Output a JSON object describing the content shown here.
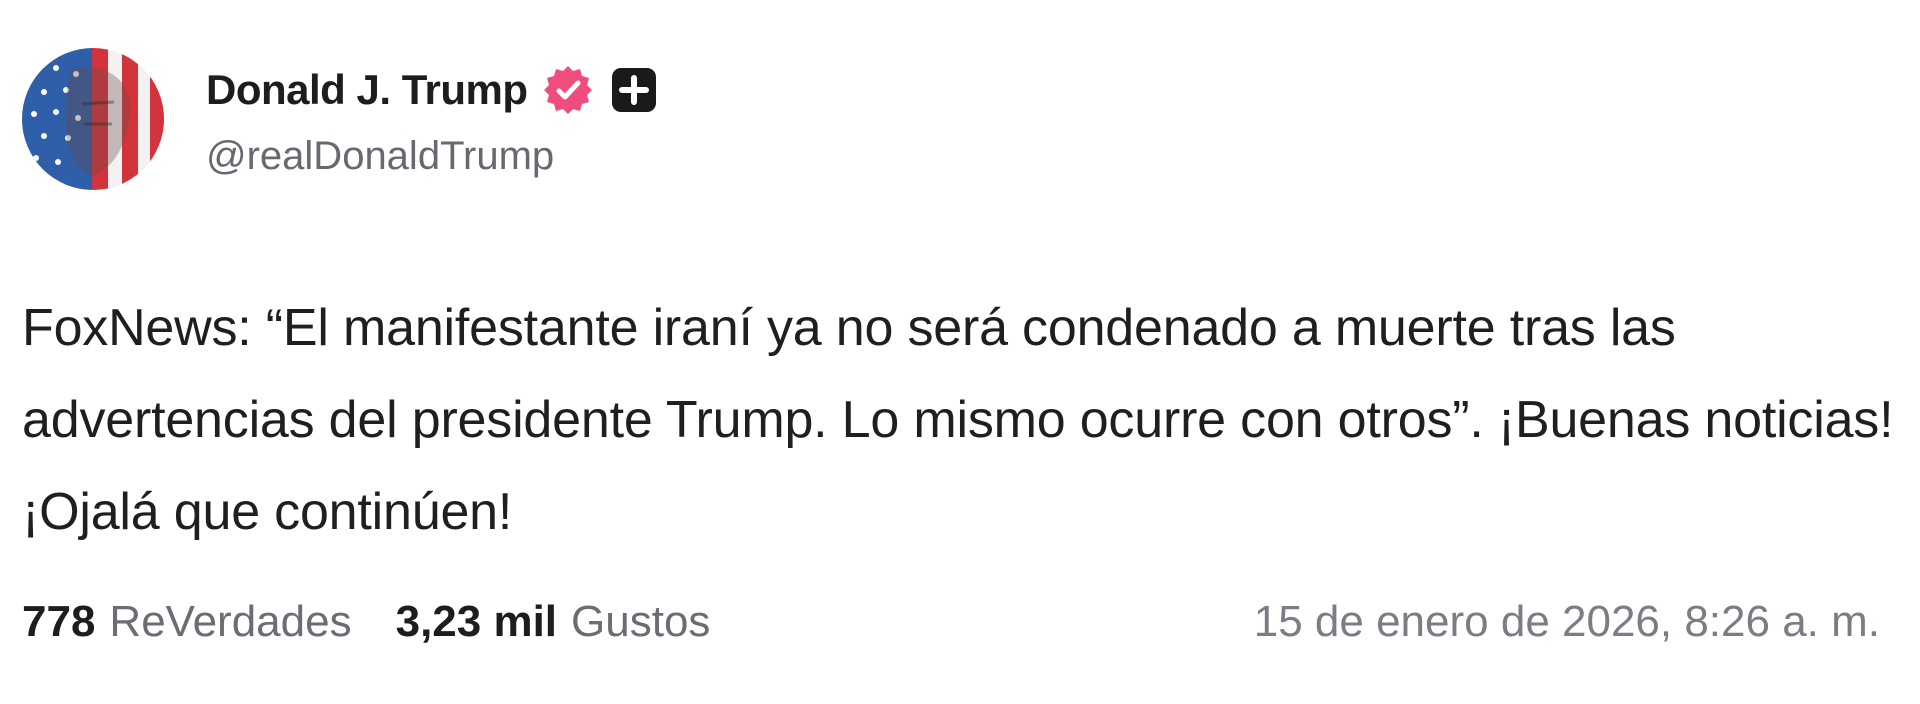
{
  "author": {
    "display_name": "Donald J. Trump",
    "handle": "@realDonaldTrump",
    "avatar_icon": "american-flag-portrait-avatar",
    "verified_icon": "verified-badge-icon",
    "verified_color": "#ee4d7d",
    "plus_icon": "plus-square-icon"
  },
  "post": {
    "text": "FoxNews: “El manifestante iraní ya no será condenado a muerte tras las advertencias del presidente Trump. Lo mismo ocurre con otros”. ¡Buenas noticias! ¡Ojalá que continúen!"
  },
  "stats": {
    "reposts_count": "778",
    "reposts_label": "ReVerdades",
    "likes_count": "3,23 mil",
    "likes_label": "Gustos"
  },
  "timestamp": "15 de enero de 2026, 8:26 a. m."
}
